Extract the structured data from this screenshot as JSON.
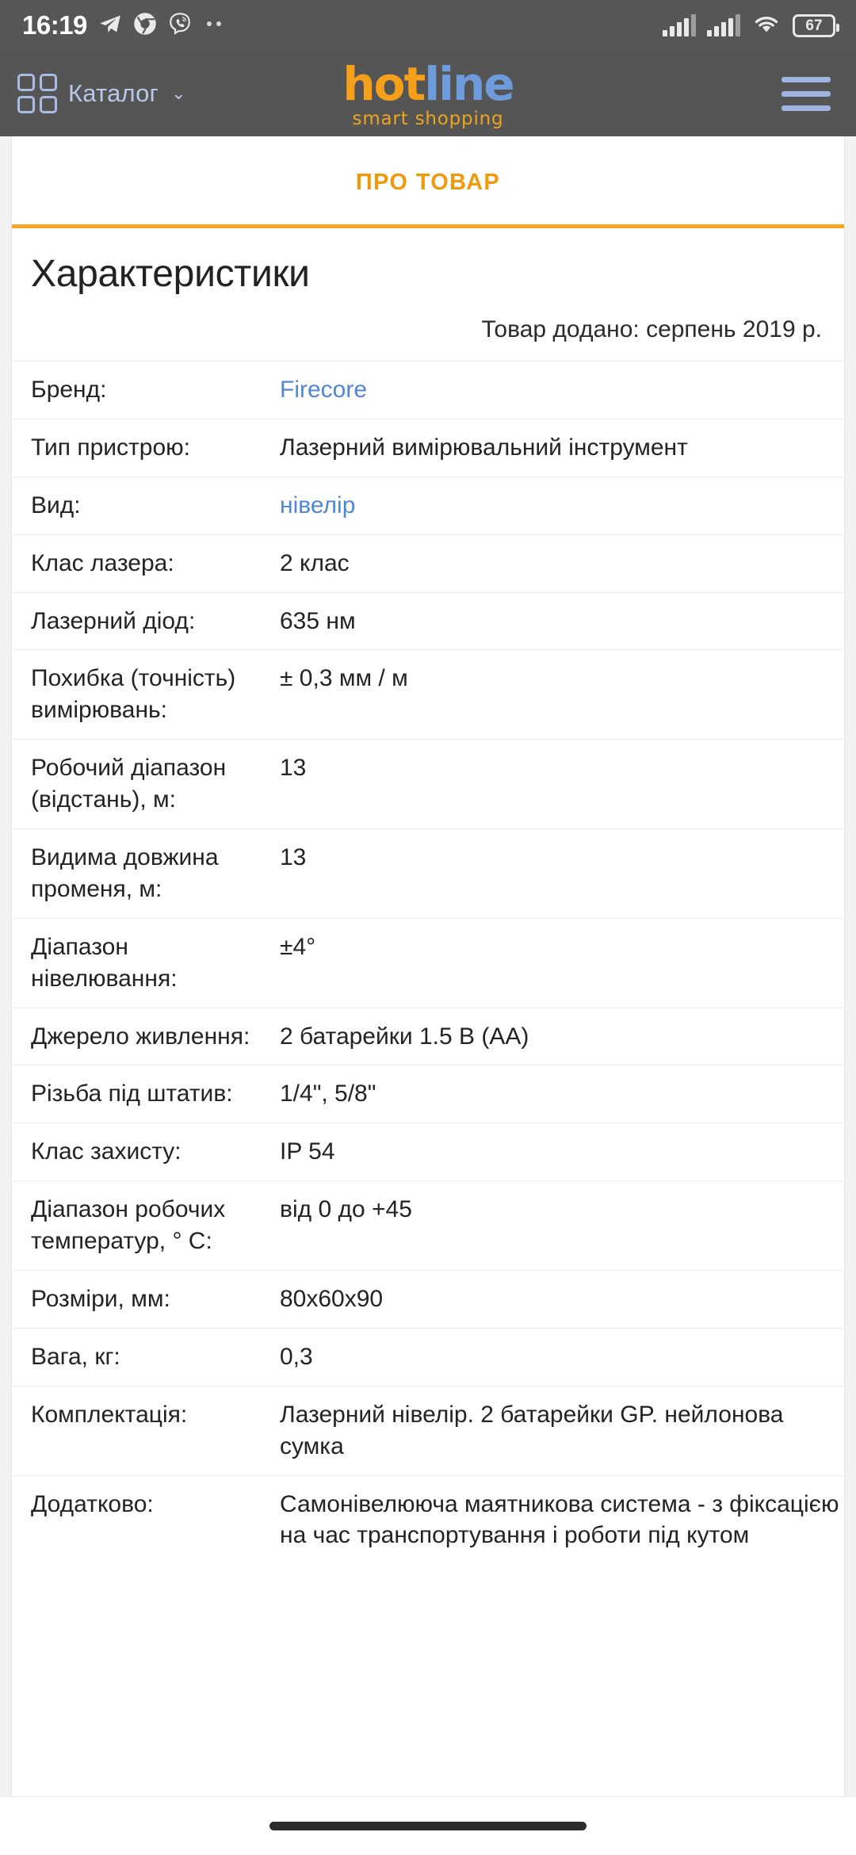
{
  "status_bar": {
    "clock": "16:19",
    "left_icons": [
      "telegram-icon",
      "chrome-icon",
      "viber-icon",
      "more-notifications-icon"
    ],
    "right_icons": [
      "signal-bars-sim1-icon",
      "signal-bars-sim2-icon",
      "wifi-icon"
    ],
    "battery_percent": "67"
  },
  "header": {
    "catalog_label": "Каталог",
    "catalog_chevron": "⌄",
    "logo_part1": "hot",
    "logo_part2": "line",
    "logo_tagline": "smart shopping",
    "menu_icon": "hamburger-menu-icon"
  },
  "tabs": {
    "active_tab": "ПРО ТОВАР"
  },
  "main": {
    "section_title": "Характеристики",
    "added_text": "Товар додано: серпень 2019 р.",
    "specs": [
      {
        "label": "Бренд:",
        "value": "Firecore",
        "is_link": true
      },
      {
        "label": "Тип пристрою:",
        "value": "Лазерний вимірювальний інструмент",
        "is_link": false
      },
      {
        "label": "Вид:",
        "value": "нівелір",
        "is_link": true
      },
      {
        "label": "Клас лазера:",
        "value": "2 клас",
        "is_link": false
      },
      {
        "label": "Лазерний діод:",
        "value": "635 нм",
        "is_link": false
      },
      {
        "label": "Похибка (точність) вимірювань:",
        "value": "± 0,3 мм / м",
        "is_link": false
      },
      {
        "label": "Робочий діапазон (відстань), м:",
        "value": "13",
        "is_link": false
      },
      {
        "label": "Видима довжина променя, м:",
        "value": "13",
        "is_link": false
      },
      {
        "label": "Діапазон нівелювання:",
        "value": "±4°",
        "is_link": false
      },
      {
        "label": "Джерело живлення:",
        "value": "2 батарейки 1.5 В (АА)",
        "is_link": false
      },
      {
        "label": "Різьба під штатив:",
        "value": "1/4\", 5/8\"",
        "is_link": false
      },
      {
        "label": "Клас захисту:",
        "value": "IP 54",
        "is_link": false
      },
      {
        "label": "Діапазон робочих температур, ° С:",
        "value": "від 0 до +45",
        "is_link": false
      },
      {
        "label": "Розміри, мм:",
        "value": "80x60x90",
        "is_link": false
      },
      {
        "label": "Вага, кг:",
        "value": "0,3",
        "is_link": false
      },
      {
        "label": "Комплектація:",
        "value": "Лазерний нівелір. 2 батарейки GP. нейлонова сумка",
        "is_link": false
      },
      {
        "label": "Додатково:",
        "value": "Самонівелююча маятникова система - з фіксацією на час транспортування і роботи під кутом",
        "is_link": false
      }
    ]
  },
  "colors": {
    "accent_orange": "#f5a623",
    "link_blue": "#5087d2",
    "header_gray": "#555555",
    "logo_orange": "#f6a01a",
    "logo_blue": "#6e9bdc"
  },
  "nav_bar": {
    "gesture_pill": "home-gesture-pill"
  }
}
